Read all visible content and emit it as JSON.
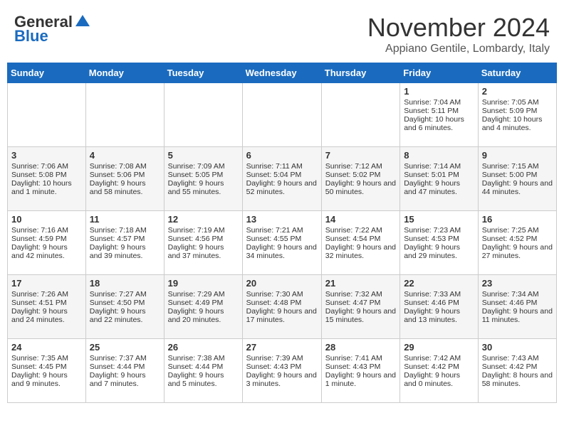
{
  "header": {
    "logo_general": "General",
    "logo_blue": "Blue",
    "month_title": "November 2024",
    "location": "Appiano Gentile, Lombardy, Italy"
  },
  "days_of_week": [
    "Sunday",
    "Monday",
    "Tuesday",
    "Wednesday",
    "Thursday",
    "Friday",
    "Saturday"
  ],
  "weeks": [
    [
      {
        "day": "",
        "content": ""
      },
      {
        "day": "",
        "content": ""
      },
      {
        "day": "",
        "content": ""
      },
      {
        "day": "",
        "content": ""
      },
      {
        "day": "",
        "content": ""
      },
      {
        "day": "1",
        "content": "Sunrise: 7:04 AM\nSunset: 5:11 PM\nDaylight: 10 hours and 6 minutes."
      },
      {
        "day": "2",
        "content": "Sunrise: 7:05 AM\nSunset: 5:09 PM\nDaylight: 10 hours and 4 minutes."
      }
    ],
    [
      {
        "day": "3",
        "content": "Sunrise: 7:06 AM\nSunset: 5:08 PM\nDaylight: 10 hours and 1 minute."
      },
      {
        "day": "4",
        "content": "Sunrise: 7:08 AM\nSunset: 5:06 PM\nDaylight: 9 hours and 58 minutes."
      },
      {
        "day": "5",
        "content": "Sunrise: 7:09 AM\nSunset: 5:05 PM\nDaylight: 9 hours and 55 minutes."
      },
      {
        "day": "6",
        "content": "Sunrise: 7:11 AM\nSunset: 5:04 PM\nDaylight: 9 hours and 52 minutes."
      },
      {
        "day": "7",
        "content": "Sunrise: 7:12 AM\nSunset: 5:02 PM\nDaylight: 9 hours and 50 minutes."
      },
      {
        "day": "8",
        "content": "Sunrise: 7:14 AM\nSunset: 5:01 PM\nDaylight: 9 hours and 47 minutes."
      },
      {
        "day": "9",
        "content": "Sunrise: 7:15 AM\nSunset: 5:00 PM\nDaylight: 9 hours and 44 minutes."
      }
    ],
    [
      {
        "day": "10",
        "content": "Sunrise: 7:16 AM\nSunset: 4:59 PM\nDaylight: 9 hours and 42 minutes."
      },
      {
        "day": "11",
        "content": "Sunrise: 7:18 AM\nSunset: 4:57 PM\nDaylight: 9 hours and 39 minutes."
      },
      {
        "day": "12",
        "content": "Sunrise: 7:19 AM\nSunset: 4:56 PM\nDaylight: 9 hours and 37 minutes."
      },
      {
        "day": "13",
        "content": "Sunrise: 7:21 AM\nSunset: 4:55 PM\nDaylight: 9 hours and 34 minutes."
      },
      {
        "day": "14",
        "content": "Sunrise: 7:22 AM\nSunset: 4:54 PM\nDaylight: 9 hours and 32 minutes."
      },
      {
        "day": "15",
        "content": "Sunrise: 7:23 AM\nSunset: 4:53 PM\nDaylight: 9 hours and 29 minutes."
      },
      {
        "day": "16",
        "content": "Sunrise: 7:25 AM\nSunset: 4:52 PM\nDaylight: 9 hours and 27 minutes."
      }
    ],
    [
      {
        "day": "17",
        "content": "Sunrise: 7:26 AM\nSunset: 4:51 PM\nDaylight: 9 hours and 24 minutes."
      },
      {
        "day": "18",
        "content": "Sunrise: 7:27 AM\nSunset: 4:50 PM\nDaylight: 9 hours and 22 minutes."
      },
      {
        "day": "19",
        "content": "Sunrise: 7:29 AM\nSunset: 4:49 PM\nDaylight: 9 hours and 20 minutes."
      },
      {
        "day": "20",
        "content": "Sunrise: 7:30 AM\nSunset: 4:48 PM\nDaylight: 9 hours and 17 minutes."
      },
      {
        "day": "21",
        "content": "Sunrise: 7:32 AM\nSunset: 4:47 PM\nDaylight: 9 hours and 15 minutes."
      },
      {
        "day": "22",
        "content": "Sunrise: 7:33 AM\nSunset: 4:46 PM\nDaylight: 9 hours and 13 minutes."
      },
      {
        "day": "23",
        "content": "Sunrise: 7:34 AM\nSunset: 4:46 PM\nDaylight: 9 hours and 11 minutes."
      }
    ],
    [
      {
        "day": "24",
        "content": "Sunrise: 7:35 AM\nSunset: 4:45 PM\nDaylight: 9 hours and 9 minutes."
      },
      {
        "day": "25",
        "content": "Sunrise: 7:37 AM\nSunset: 4:44 PM\nDaylight: 9 hours and 7 minutes."
      },
      {
        "day": "26",
        "content": "Sunrise: 7:38 AM\nSunset: 4:44 PM\nDaylight: 9 hours and 5 minutes."
      },
      {
        "day": "27",
        "content": "Sunrise: 7:39 AM\nSunset: 4:43 PM\nDaylight: 9 hours and 3 minutes."
      },
      {
        "day": "28",
        "content": "Sunrise: 7:41 AM\nSunset: 4:43 PM\nDaylight: 9 hours and 1 minute."
      },
      {
        "day": "29",
        "content": "Sunrise: 7:42 AM\nSunset: 4:42 PM\nDaylight: 9 hours and 0 minutes."
      },
      {
        "day": "30",
        "content": "Sunrise: 7:43 AM\nSunset: 4:42 PM\nDaylight: 8 hours and 58 minutes."
      }
    ]
  ]
}
